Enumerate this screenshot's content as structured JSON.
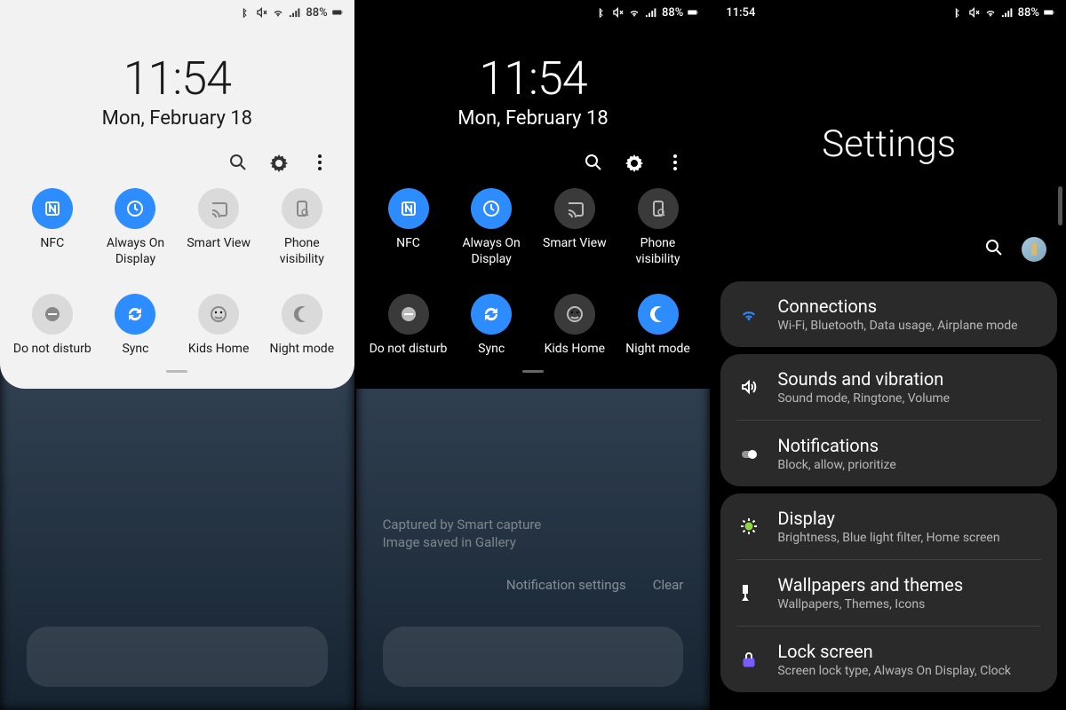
{
  "status": {
    "time": "11:54",
    "battery": "88%"
  },
  "clock": {
    "time": "11:54",
    "date": "Mon, February 18"
  },
  "toggles_light": {
    "nfc": {
      "label": "NFC",
      "on": true
    },
    "aod": {
      "label": "Always On Display",
      "on": true
    },
    "smartview": {
      "label": "Smart View",
      "on": false
    },
    "phonevis": {
      "label": "Phone visibility",
      "on": false
    },
    "dnd": {
      "label": "Do not disturb",
      "on": false
    },
    "sync": {
      "label": "Sync",
      "on": true
    },
    "kids": {
      "label": "Kids Home",
      "on": false
    },
    "night": {
      "label": "Night mode",
      "on": false
    }
  },
  "toggles_dark": {
    "nfc": {
      "label": "NFC",
      "on": true
    },
    "aod": {
      "label": "Always On Display",
      "on": true
    },
    "smartview": {
      "label": "Smart View",
      "on": false
    },
    "phonevis": {
      "label": "Phone visibility",
      "on": false
    },
    "dnd": {
      "label": "Do not disturb",
      "on": false
    },
    "sync": {
      "label": "Sync",
      "on": true
    },
    "kids": {
      "label": "Kids Home",
      "on": false
    },
    "night": {
      "label": "Night mode",
      "on": true
    }
  },
  "notif_hint": {
    "line1": "",
    "line2": "Captured by Smart capture",
    "line3": "Image saved in Gallery",
    "btn1": "Notification settings",
    "btn2": "Clear"
  },
  "settings": {
    "title": "Settings",
    "groups": [
      {
        "items": [
          {
            "key": "connections",
            "title": "Connections",
            "sub": "Wi-Fi, Bluetooth, Data usage, Airplane mode",
            "color": "#2d8cff"
          }
        ]
      },
      {
        "items": [
          {
            "key": "sounds",
            "title": "Sounds and vibration",
            "sub": "Sound mode, Ringtone, Volume",
            "color": "#b84bff"
          },
          {
            "key": "notifications",
            "title": "Notifications",
            "sub": "Block, allow, prioritize",
            "color": "#ff6f4b"
          }
        ]
      },
      {
        "items": [
          {
            "key": "display",
            "title": "Display",
            "sub": "Brightness, Blue light filter, Home screen",
            "color": "#8fd63f"
          },
          {
            "key": "wallpapers",
            "title": "Wallpapers and themes",
            "sub": "Wallpapers, Themes, Icons",
            "color": "#d64bc5"
          },
          {
            "key": "lock",
            "title": "Lock screen",
            "sub": "Screen lock type, Always On Display, Clock",
            "color": "#7a5bff"
          }
        ]
      }
    ]
  }
}
